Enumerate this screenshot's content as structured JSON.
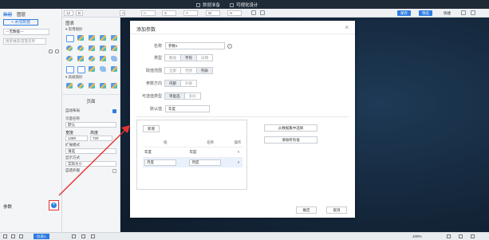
{
  "topbar": {
    "tabs": [
      {
        "label": "数据准备",
        "active": false
      },
      {
        "label": "可视化设计",
        "active": true
      }
    ]
  },
  "toolbar": {
    "font_size": "12",
    "save_label": "保存",
    "preview_label": "预览",
    "shortcut_label": "快捷"
  },
  "leftpanel": {
    "tabs": [
      "数据",
      "图层"
    ],
    "add_dataset": "+ 添加数据",
    "dataset_select": "---无数据---",
    "search_placeholder": "搜索维度/度量名称",
    "param_label": "参数",
    "add_param_icon": "plus-icon"
  },
  "chartpanel": {
    "title": "图表",
    "common_label": "常用图形",
    "advanced_label": "高级图形",
    "page_title": "页面",
    "auto_layout": "自动布局",
    "page_name_label": "页面名称",
    "page_name": "默认",
    "width_label": "宽度",
    "height_label": "高度",
    "width": "1280",
    "height": "720",
    "expand_label": "扩展模式",
    "expand_value": "请选",
    "display_label": "显示方式",
    "display_value": "实际大小",
    "adapt_label": "自适外观"
  },
  "statusbar": {
    "page_tab": "仪表1",
    "zoom": "100%"
  },
  "modal": {
    "title": "添加参数",
    "close_icon": "close-icon",
    "name_label": "名称",
    "name_value": "参数1",
    "type_label": "类型",
    "type_options": [
      "数值",
      "字符",
      "日期"
    ],
    "type_selected": "字符",
    "range_label": "取值范围",
    "range_options": [
      "全部",
      "范围",
      "列表"
    ],
    "range_selected": "列表",
    "direction_label": "参数方向",
    "direction_options": [
      "内部",
      "外部"
    ],
    "direction_selected": "内部",
    "valuetype_label": "可选值类型",
    "valuetype_options": [
      "单复选",
      "多问"
    ],
    "valuetype_selected": "单复选",
    "default_label": "默认值",
    "default_value": "年度",
    "new_button": "新增",
    "table_headers": [
      "值",
      "名称",
      "操作"
    ],
    "table_rows": [
      {
        "value": "年度",
        "name": "年度",
        "op": "×"
      },
      {
        "value": "月度",
        "name": "月度",
        "op": "×"
      }
    ],
    "from_dataset_button": "从数据集中选择",
    "clear_all_button": "清除所有值",
    "ok_button": "确定",
    "cancel_button": "取消"
  },
  "colors": {
    "accent": "#2f7de1",
    "arrow": "#e33333"
  }
}
